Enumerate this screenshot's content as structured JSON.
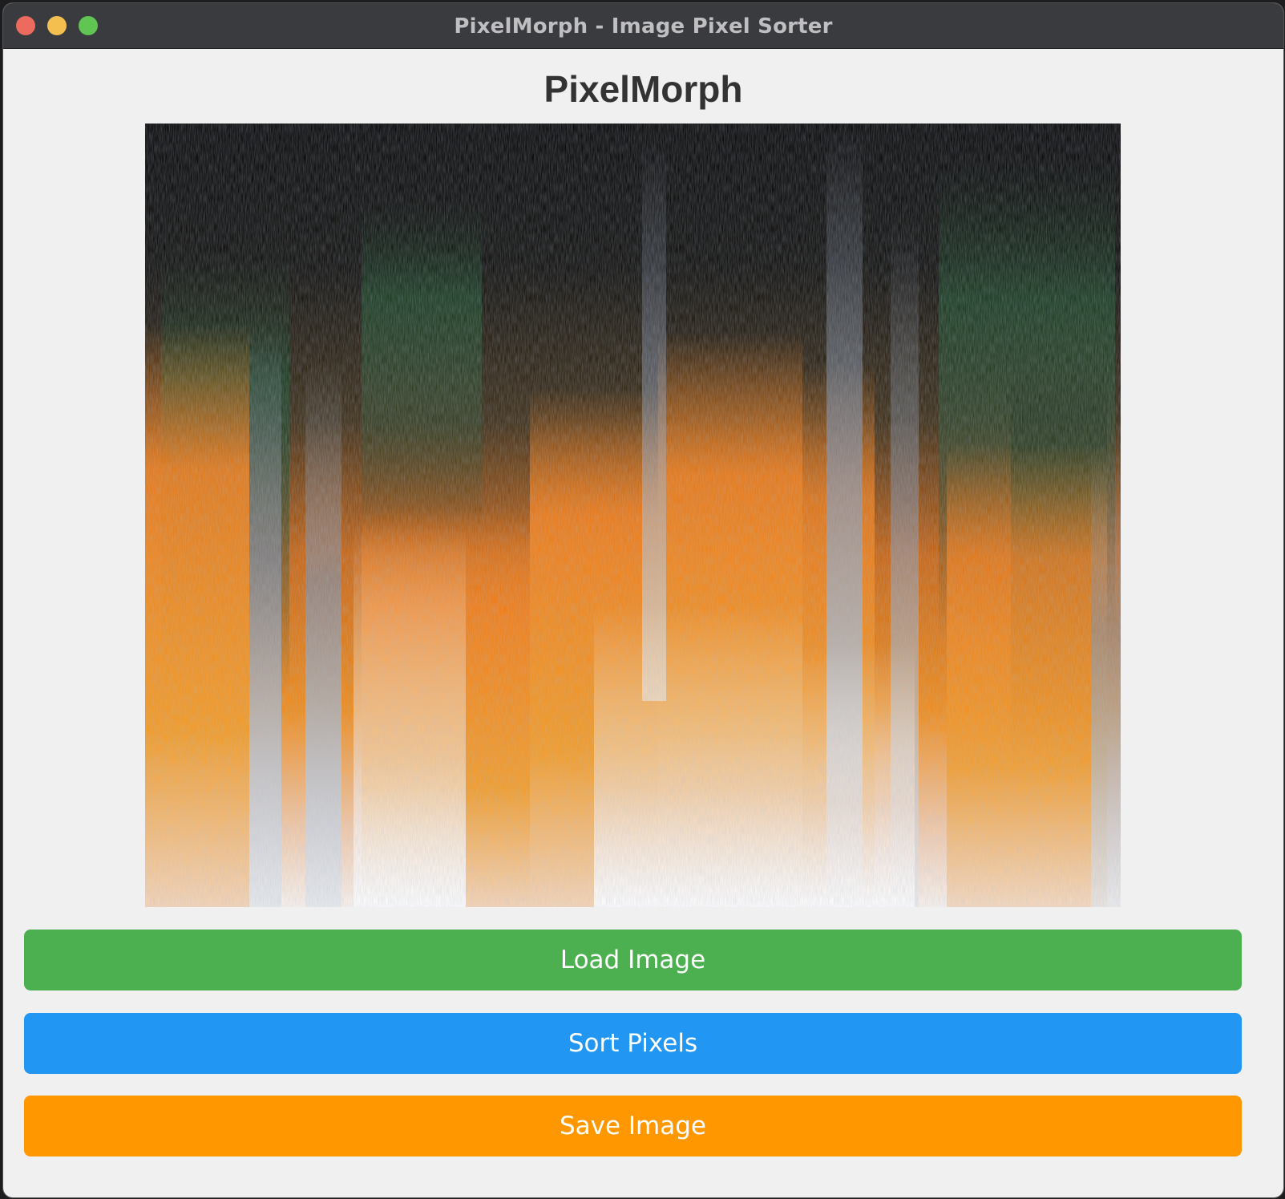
{
  "window": {
    "title": "PixelMorph - Image Pixel Sorter"
  },
  "app": {
    "heading": "PixelMorph"
  },
  "buttons": {
    "load_label": "Load Image",
    "sort_label": "Sort Pixels",
    "save_label": "Save Image"
  },
  "colors": {
    "load": "#4caf50",
    "sort": "#2196f3",
    "save": "#ff9800",
    "background": "#f0f0f0"
  }
}
